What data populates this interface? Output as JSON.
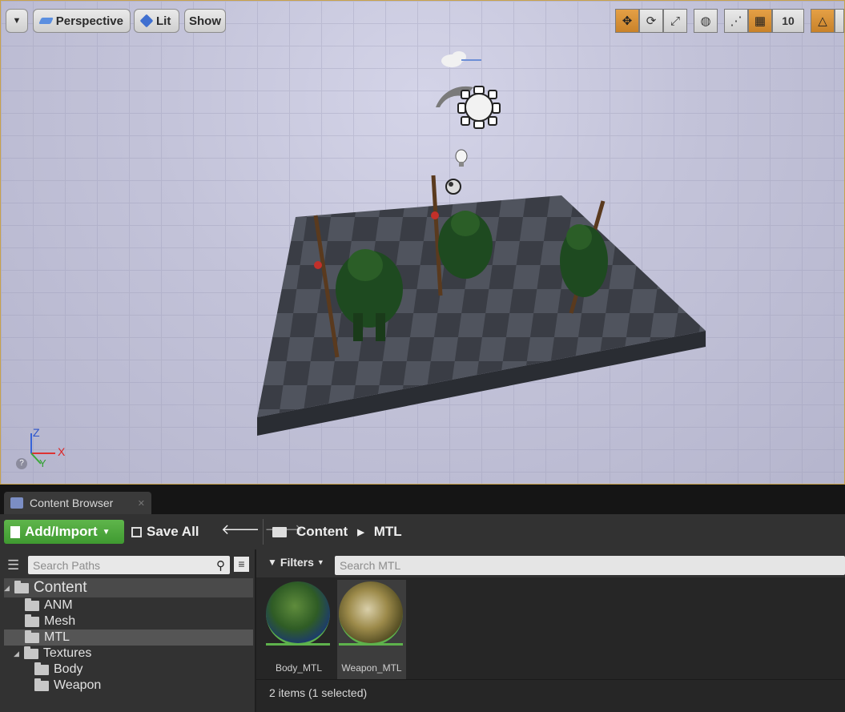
{
  "viewport": {
    "view_mode": "Perspective",
    "lighting": "Lit",
    "show_label": "Show",
    "grid_snap_value": "10",
    "axis": {
      "x": "X",
      "y": "Y",
      "z": "Z"
    }
  },
  "content_browser": {
    "tab_title": "Content Browser",
    "toolbar": {
      "add_import_label": "Add/Import",
      "save_all_label": "Save All"
    },
    "breadcrumb": [
      "Content",
      "MTL"
    ],
    "search_paths_placeholder": "Search Paths",
    "tree": [
      {
        "label": "Content",
        "level": 0,
        "expanded": true,
        "highlighted": true
      },
      {
        "label": "ANM",
        "level": 1
      },
      {
        "label": "Mesh",
        "level": 1
      },
      {
        "label": "MTL",
        "level": 1,
        "selected": true
      },
      {
        "label": "Textures",
        "level": 1,
        "expanded": true
      },
      {
        "label": "Body",
        "level": 2
      },
      {
        "label": "Weapon",
        "level": 2
      }
    ],
    "filters_label": "Filters",
    "search_assets_placeholder": "Search MTL",
    "assets": [
      {
        "name": "Body_MTL",
        "selected": false
      },
      {
        "name": "Weapon_MTL",
        "selected": true
      }
    ],
    "status": "2 items (1 selected)"
  },
  "colors": {
    "accent_orange": "#d08b35",
    "add_button_green": "#4faa3d",
    "panel_bg": "#323232"
  }
}
